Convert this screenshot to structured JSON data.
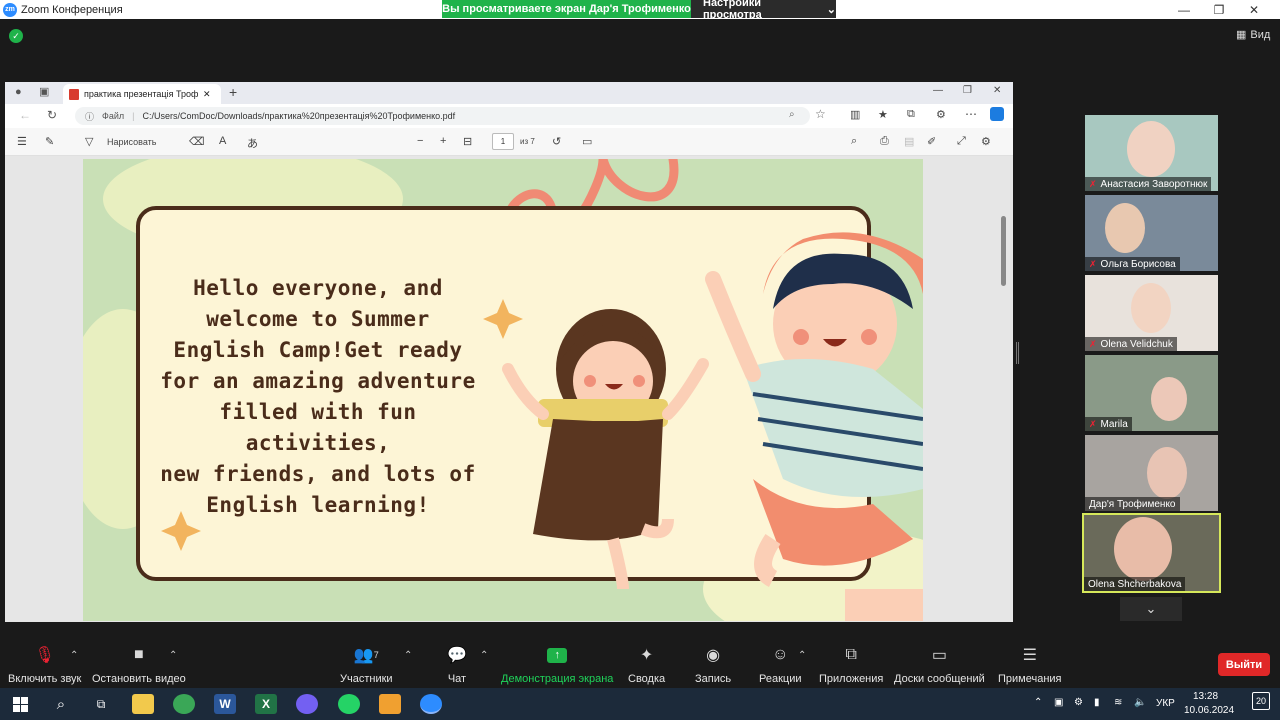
{
  "window": {
    "app_logo": "zm",
    "title": "Zoom Конференция",
    "controls": [
      "—",
      "❐",
      "✕"
    ]
  },
  "banner": {
    "sharing_text": "Вы просматриваете экран Дар'я Трофименко",
    "view_settings": "Настройки просмотра"
  },
  "top_right": {
    "view_label": "Вид"
  },
  "browser": {
    "tab_title": "практика презентація Трофименко",
    "address_label": "Файл",
    "url": "C:/Users/ComDoc/Downloads/практика%20презентація%20Трофименко.pdf",
    "draw_label": "Нарисовать",
    "page_current": "1",
    "page_total": "из 7"
  },
  "slide": {
    "lines": [
      "Hello everyone, and",
      "welcome to Summer",
      "English Camp!Get ready",
      "for an amazing adventure",
      "filled with fun activities,",
      "new friends, and lots of",
      "English learning!"
    ]
  },
  "participants_panel": [
    {
      "name": "Анастасия Заворотнюк",
      "muted": true
    },
    {
      "name": "Ольга Борисова",
      "muted": true
    },
    {
      "name": "Olena Velidchuk",
      "muted": true
    },
    {
      "name": "Marila",
      "muted": true
    },
    {
      "name": "Дар'я Трофименко",
      "muted": false
    },
    {
      "name": "Olena Shcherbakova",
      "muted": false
    }
  ],
  "toolbar": {
    "unmute": "Включить звук",
    "stop_video": "Остановить видео",
    "participants": "Участники",
    "participants_count": "7",
    "chat": "Чат",
    "share_screen": "Демонстрация экрана",
    "summary": "Сводка",
    "record": "Запись",
    "reactions": "Реакции",
    "apps": "Приложения",
    "whiteboards": "Доски сообщений",
    "notes": "Примечания",
    "leave": "Выйти"
  },
  "taskbar": {
    "lang": "УКР",
    "time": "13:28",
    "date": "10.06.2024",
    "notifications": "20"
  },
  "colors": {
    "share_green": "#1fb34a",
    "leave_red": "#e02828",
    "slide_brown": "#4a2c1a",
    "active_tile": "#d6e85a"
  }
}
